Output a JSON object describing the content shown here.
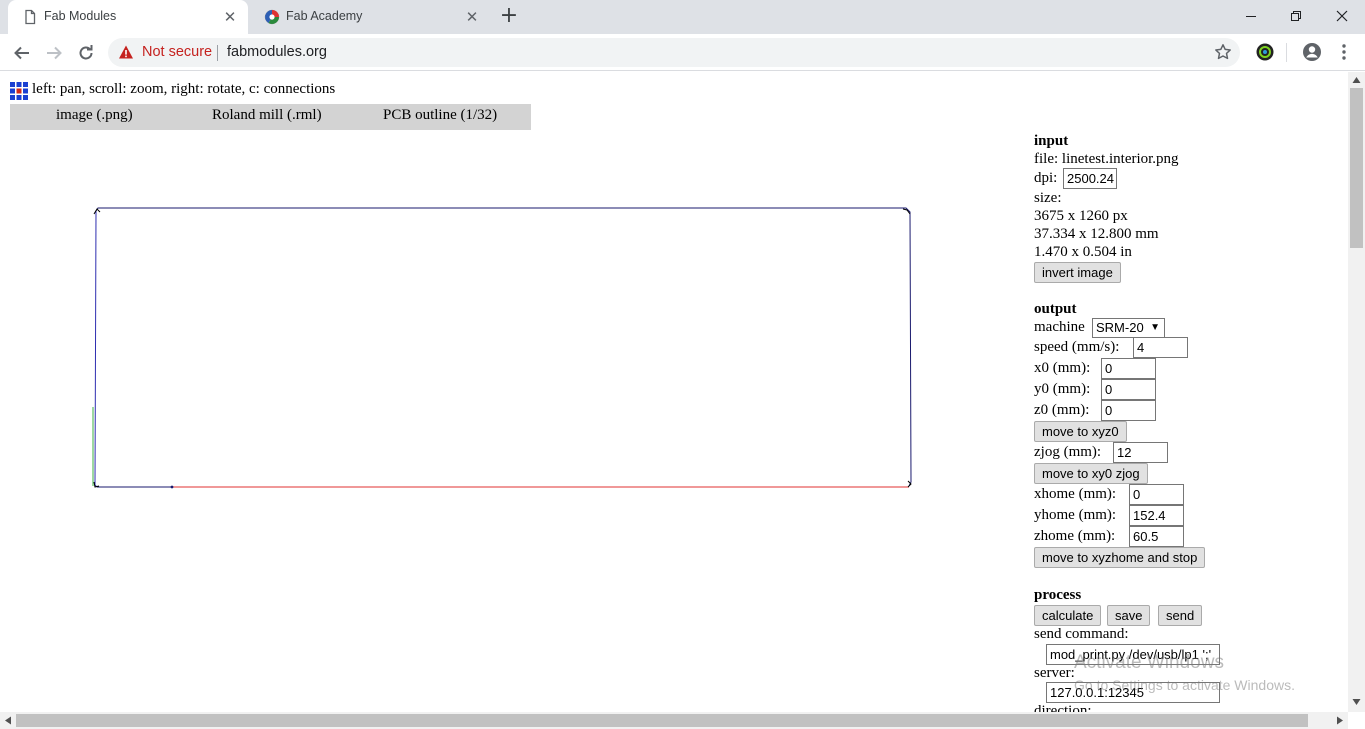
{
  "browser": {
    "tabs": [
      {
        "title": "Fab Modules",
        "icon": "page-icon",
        "active": true
      },
      {
        "title": "Fab Academy",
        "icon": "fab-academy-icon",
        "active": false
      }
    ],
    "new_tab_label": "+",
    "security_label": "Not secure",
    "url": "fabmodules.org"
  },
  "page": {
    "help_text": "left: pan, scroll: zoom, right: rotate, c: connections",
    "menus": {
      "image": "image (.png)",
      "output": "Roland mill (.rml)",
      "process": "PCB outline (1/32)"
    }
  },
  "panel": {
    "input": {
      "title": "input",
      "file_label": "file: linetest.interior.png",
      "dpi_label": "dpi:",
      "dpi_value": "2500.24",
      "size_label": "size:",
      "size_px": "3675 x 1260 px",
      "size_mm": "37.334 x 12.800 mm",
      "size_in": "1.470 x 0.504 in",
      "invert_button": "invert image"
    },
    "output": {
      "title": "output",
      "machine_label": "machine",
      "machine_value": "SRM-20",
      "speed_label": "speed (mm/s):",
      "speed_value": "4",
      "x0_label": "x0 (mm):",
      "x0_value": "0",
      "y0_label": "y0 (mm):",
      "y0_value": "0",
      "z0_label": "z0 (mm):",
      "z0_value": "0",
      "move_xyz0_button": "move to xyz0",
      "zjog_label": "zjog (mm):",
      "zjog_value": "12",
      "move_xy0_button": "move to xy0 zjog",
      "xhome_label": "xhome (mm):",
      "xhome_value": "0",
      "yhome_label": "yhome (mm):",
      "yhome_value": "152.4",
      "zhome_label": "zhome (mm):",
      "zhome_value": "60.5",
      "move_home_button": "move to xyzhome and stop"
    },
    "process": {
      "title": "process",
      "calculate_button": "calculate",
      "save_button": "save",
      "send_button": "send",
      "send_command_label": "send command:",
      "send_command_value": "mod_print.py /dev/usb/lp1 ';'",
      "server_label": "server:",
      "server_value": "127.0.0.1:12345",
      "direction_label": "direction:"
    }
  },
  "watermark": {
    "line1": "Activate Windows",
    "line2": "Go to Settings to activate Windows."
  },
  "colors": {
    "path_primary": "#1a1a6e",
    "path_red": "#e03030",
    "path_green": "#3cb043",
    "menubar": "#d3d3d3"
  }
}
